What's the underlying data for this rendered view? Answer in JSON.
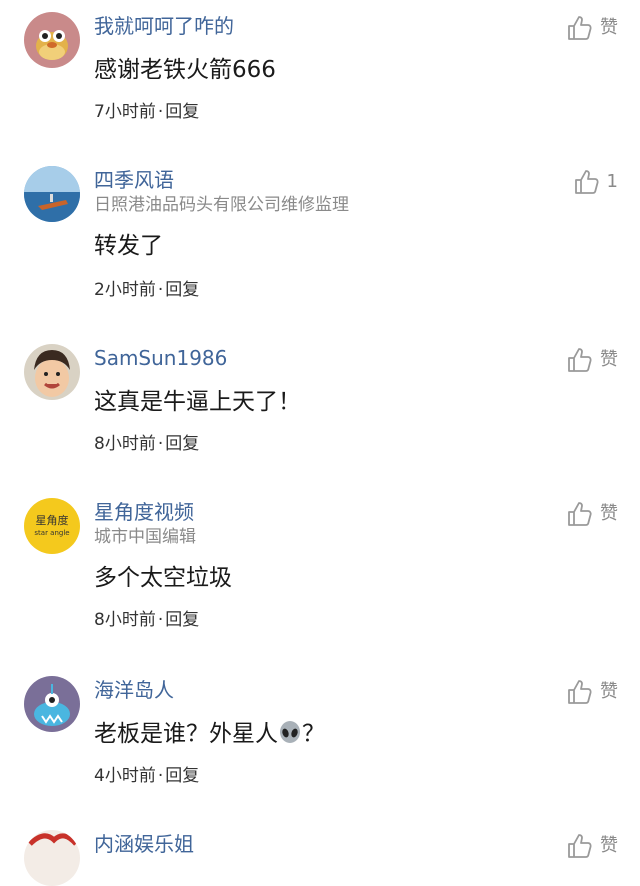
{
  "comments": [
    {
      "username": "我就呵呵了咋的",
      "subtitle": "",
      "text": "感谢老铁火箭666",
      "time": "7小时前",
      "reply": "回复",
      "like": "赞",
      "avatar": "cartoon-bird-avatar"
    },
    {
      "username": "四季风语",
      "subtitle": "日照港油品码头有限公司维修监理",
      "text": "转发了",
      "time": "2小时前",
      "reply": "回复",
      "like": "1",
      "avatar": "sea-boat-avatar"
    },
    {
      "username": "SamSun1986",
      "subtitle": "",
      "text": "这真是牛逼上天了！",
      "time": "8小时前",
      "reply": "回复",
      "like": "赞",
      "avatar": "child-photo-avatar"
    },
    {
      "username": "星角度视频",
      "subtitle": "城市中国编辑",
      "text": "多个太空垃圾",
      "time": "8小时前",
      "reply": "回复",
      "like": "赞",
      "avatar": "star-angle-logo-avatar",
      "avatar_text": "星角度",
      "avatar_subtext": "star angle"
    },
    {
      "username": "海洋岛人",
      "subtitle": "",
      "text": "老板是谁？外星人",
      "text_suffix": "？",
      "emoji": "alien-emoji",
      "time": "4小时前",
      "reply": "回复",
      "like": "赞",
      "avatar": "blue-monster-avatar"
    },
    {
      "username": "内涵娱乐姐",
      "subtitle": "",
      "text": "",
      "time": "",
      "reply": "",
      "like": "赞",
      "avatar": "red-cartoon-avatar"
    }
  ],
  "separator": "·",
  "colors": {
    "username": "#406599",
    "subtitle": "#8a8a8a",
    "text": "#1a1a1a",
    "meta": "#333333",
    "icon": "#9a9a9a"
  }
}
